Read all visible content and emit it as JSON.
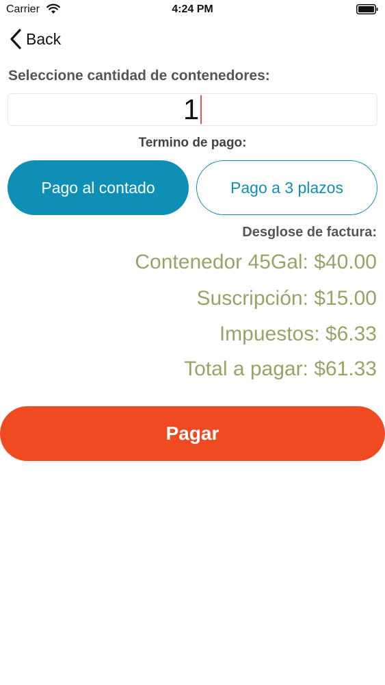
{
  "status_bar": {
    "carrier": "Carrier",
    "time": "4:24 PM",
    "wifi_icon": "wifi-icon",
    "battery_icon": "battery-icon"
  },
  "nav": {
    "back_label": "Back",
    "back_icon": "chevron-left-icon"
  },
  "form": {
    "quantity_label": "Seleccione cantidad de contenedores:",
    "quantity_value": "1",
    "term_label": "Termino de pago:",
    "payment_options": [
      {
        "label": "Pago al contado",
        "selected": true
      },
      {
        "label": "Pago a 3 plazos",
        "selected": false
      }
    ]
  },
  "invoice": {
    "title": "Desglose de factura:",
    "items": [
      {
        "text": "Contenedor 45Gal: $40.00"
      },
      {
        "text": "Suscripción: $15.00"
      },
      {
        "text": "Impuestos: $6.33"
      },
      {
        "text": "Total a pagar: $61.33"
      }
    ]
  },
  "actions": {
    "pay_label": "Pagar"
  },
  "colors": {
    "accent_blue": "#0e8fb5",
    "pay_orange": "#f04a23",
    "invoice_olive": "#9aa267",
    "caret_red": "#e2574c"
  }
}
